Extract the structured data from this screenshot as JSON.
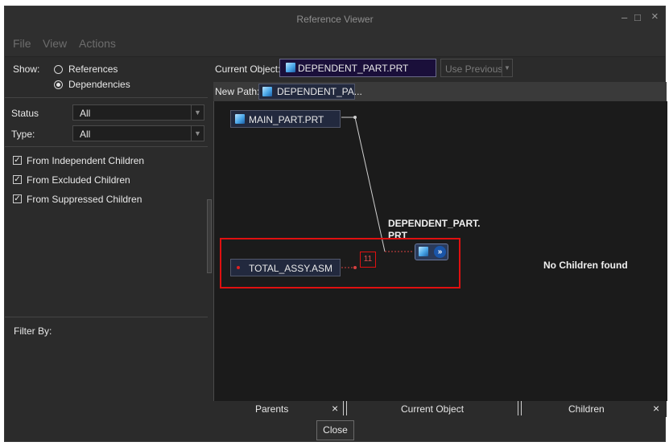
{
  "window": {
    "title": "Reference Viewer",
    "minimize": "–",
    "maximize": "□",
    "close": "×"
  },
  "menu": {
    "items": [
      "File",
      "View",
      "Actions"
    ]
  },
  "show": {
    "label": "Show:",
    "options": [
      "References",
      "Dependencies"
    ],
    "selected": "Dependencies"
  },
  "filters": {
    "status_label": "Status",
    "status_value": "All",
    "type_label": "Type:",
    "type_value": "All",
    "checks": [
      {
        "label": "From Independent Children",
        "checked": true
      },
      {
        "label": "From Excluded Children",
        "checked": true
      },
      {
        "label": "From Suppressed Children",
        "checked": true
      }
    ],
    "filter_by_label": "Filter By:"
  },
  "toolbar": {
    "current_object_label": "Current Object:",
    "current_object_value": "DEPENDENT_PART.PRT",
    "use_previous_label": "Use Previous",
    "new_path_label": "New Path:",
    "new_path_value": "DEPENDENT_PA..."
  },
  "graph": {
    "parents": [
      "MAIN_PART.PRT",
      "TOTAL_ASSY.ASM"
    ],
    "current_label_line1": "DEPENDENT_PART.",
    "current_label_line2": "PRT",
    "badge": "11",
    "no_children": "No Children found"
  },
  "bottom_tabs": {
    "parents": "Parents",
    "current": "Current Object",
    "children": "Children",
    "close_x": "×"
  },
  "close_button": "Close",
  "colors": {
    "highlight": "#e01010",
    "accent_blue": "#1a55a8",
    "canvas": "#1b1b1b"
  }
}
